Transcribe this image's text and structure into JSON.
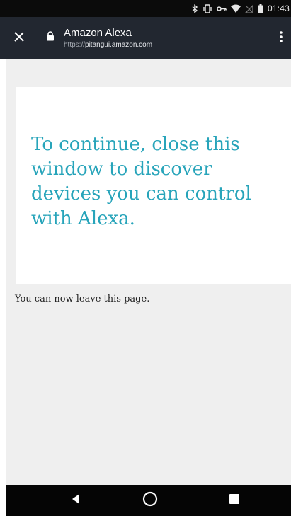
{
  "status_bar": {
    "time": "01:43",
    "icons": [
      "bluetooth-icon",
      "vibrate-icon",
      "vpn-key-icon",
      "wifi-icon",
      "no-signal-icon",
      "battery-icon"
    ]
  },
  "toolbar": {
    "title": "Amazon Alexa",
    "url_scheme": "https://",
    "url_domain": "pitangui.amazon.com",
    "close_icon": "close-icon",
    "lock_icon": "lock-icon",
    "menu_icon": "more-vert-icon"
  },
  "page": {
    "message": "To continue, close this window to discover devices you can control with Alexa.",
    "leave_text": "You can now leave this page."
  },
  "colors": {
    "toolbar": "#222730",
    "message_text": "#27a4ba",
    "page_background": "#efefef"
  },
  "nav_bar": {
    "buttons": [
      "back-icon",
      "home-icon",
      "recents-icon"
    ]
  }
}
